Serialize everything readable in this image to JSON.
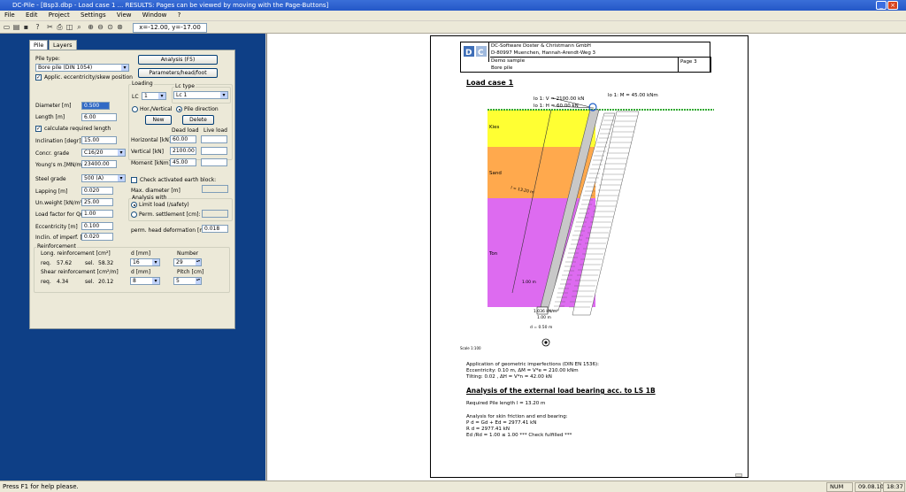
{
  "window": {
    "title": "DC-Pile - [Bsp3.dbp - Load case 1 ... RESULTS: Pages can be viewed by moving with the Page-Buttons]"
  },
  "menu": [
    "File",
    "Edit",
    "Project",
    "Settings",
    "View",
    "Window",
    "?"
  ],
  "toolbar": {
    "coordinates": "x=-12.00, y=-17.00"
  },
  "tabs": [
    "Pile",
    "Layers"
  ],
  "form": {
    "pile_type_label": "Pile type:",
    "pile_type": "Bore pile (DIN 1054)",
    "applic_label": "Applic. eccentricity/skew position",
    "analysis_button": "Analysis (F5)",
    "params_button": "Parameters/head/foot",
    "diameter_label": "Diameter [m]",
    "diameter": "0.500",
    "length_label": "Length [m]",
    "length": "6.00",
    "calc_length_label": "calculate required length",
    "inclination_label": "Inclination [degr]",
    "inclination": "15.00",
    "concr_label": "Concr. grade",
    "concr": "C16/20",
    "youngs_label": "Young's m.[MN/m²]",
    "youngs": "23400.00",
    "steel_label": "Steel grade",
    "steel": "500 (A)",
    "lapping_label": "Lapping [m]",
    "lapping": "0.020",
    "unweight_label": "Un.weight [kN/m³]",
    "unweight": "25.00",
    "loadfactor_label": "Load factor for Qr:",
    "loadfactor": "1.00",
    "eccentricity_label": "Eccentricity [m]",
    "eccentricity": "0.100",
    "imperf_label": "Inclin. of imperf. [ ]",
    "imperf": "0.020",
    "loading_group": "Loading",
    "lc_label": "LC",
    "lc": "1",
    "lctype_group": "Lc type",
    "lctype": "Lc 1",
    "hor_vert_label": "Hor./Vertical",
    "pile_dir_label": "Pile direction",
    "new_button": "New",
    "delete_button": "Delete",
    "dead_load_label": "Dead load",
    "live_load_label": "Live load",
    "horizontal_label": "Horizontal [kN]",
    "horizontal": "60.00",
    "vertical_label": "Vertical [kN]",
    "vertical": "2100.00",
    "moment_label": "Moment [kNm]",
    "moment": "45.00",
    "check_earth_label": "Check activated earth block:",
    "max_diam_label": "Max. diameter [m]",
    "analysis_with_label": "Analysis with",
    "limit_load_label": "Limit load (/safety)",
    "perm_settle_label": "Perm. settlement [cm]:",
    "head_deform_label": "perm. head deformation [m]",
    "head_deform": "0.018",
    "reinforcement_group": "Reinforcement",
    "long_reinf_label": "Long. reinforcement [cm²]",
    "req_label": "req.",
    "sel_label": "sel.",
    "long_req": "57.62",
    "long_sel": "58.32",
    "d_label": "d [mm]",
    "number_label": "Number",
    "long_d": "16",
    "long_number": "29",
    "shear_reinf_label": "Shear reinforcement [cm²/m]",
    "pitch_label": "Pitch [cm]",
    "shear_req": "4.34",
    "shear_sel": "20.12",
    "shear_d": "8",
    "shear_pitch": "5"
  },
  "page": {
    "company": "DC-Software Doster & Christmann GmbH",
    "address": "D-80997 Muenchen, Hannah-Arendt-Weg 3",
    "project": "Demo sample",
    "subject": "Bore pile",
    "page_label": "Page  3",
    "load_case_title": "Load case 1",
    "load_v": "lo 1: V",
    "load_v_val": "= 2100.00 kN",
    "load_h": "lo 1: H",
    "load_h_val": "= 60.00 kN",
    "load_m": "lo 1: M",
    "load_m_val": "= 45.00 kNm",
    "layer_1": "Kies",
    "layer_2": "Sand",
    "layer_3": "Ton",
    "pile_length_annot": "l = 13.20 m",
    "dim_1": "1.00 m",
    "dim_2": "1.036 kN/m²",
    "dim_3": "1.00 m",
    "dim_4": "d = 0.50 m",
    "scale": "Scale 1:100",
    "imperf_title": "Application of geometric imperfections (DIN EN 1536):",
    "imperf_line1": "Eccentricity: 0.10 m,  ΔM = V*e =  210.00 kNm",
    "imperf_line2": "Tilting:          0.02 ,   ΔH = V*n =    42.00 kN",
    "analysis_title": "Analysis of the external load bearing acc. to LS 1B",
    "req_pile_length": "Required Pile length  l =       13.20 m",
    "skin_title": "Analysis for skin friction and end bearing:",
    "pd_line": "P d = Gd + Ed     =     2977.41 kN",
    "rd_line": "R d                  =     2977.41 kN",
    "ratio_line": "Ed /Rd = 1.00 ≤ 1.00   *** Check fulfilled ***"
  },
  "status": {
    "help": "Press F1 for help please.",
    "num": "NUM",
    "date": "09.08.10",
    "time": "18:37"
  },
  "colors": {
    "kies": "#ffff33",
    "sand": "#ffa94d",
    "ton": "#dd6bf0",
    "pane": "#0e3f86"
  }
}
